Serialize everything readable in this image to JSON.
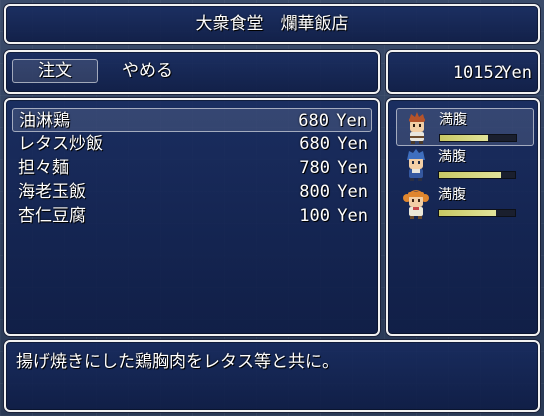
{
  "title": "大衆食堂　爛華飯店",
  "commands": {
    "order": "注文",
    "cancel": "やめる"
  },
  "gold": {
    "amount": "10152",
    "unit": "Yen"
  },
  "menu": {
    "currency": "Yen",
    "selected_index": 0,
    "items": [
      {
        "name": "油淋鶏",
        "price": "680"
      },
      {
        "name": "レタス炒飯",
        "price": "680"
      },
      {
        "name": "担々麺",
        "price": "780"
      },
      {
        "name": "海老玉飯",
        "price": "800"
      },
      {
        "name": "杏仁豆腐",
        "price": "100"
      }
    ]
  },
  "party": {
    "selected_index": 0,
    "members": [
      {
        "icon": "red-haired-hero-icon",
        "status": "満腹",
        "fullness": 0.63
      },
      {
        "icon": "blue-haired-ally-icon",
        "status": "満腹",
        "fullness": 0.82
      },
      {
        "icon": "orange-haired-girl-icon",
        "status": "満腹",
        "fullness": 0.75
      }
    ]
  },
  "help": "揚げ焼きにした鶏胸肉をレタス等と共に。",
  "colors": {
    "window": "#142a5e",
    "border": "#f2f2f2",
    "gauge": "#d8da84"
  }
}
